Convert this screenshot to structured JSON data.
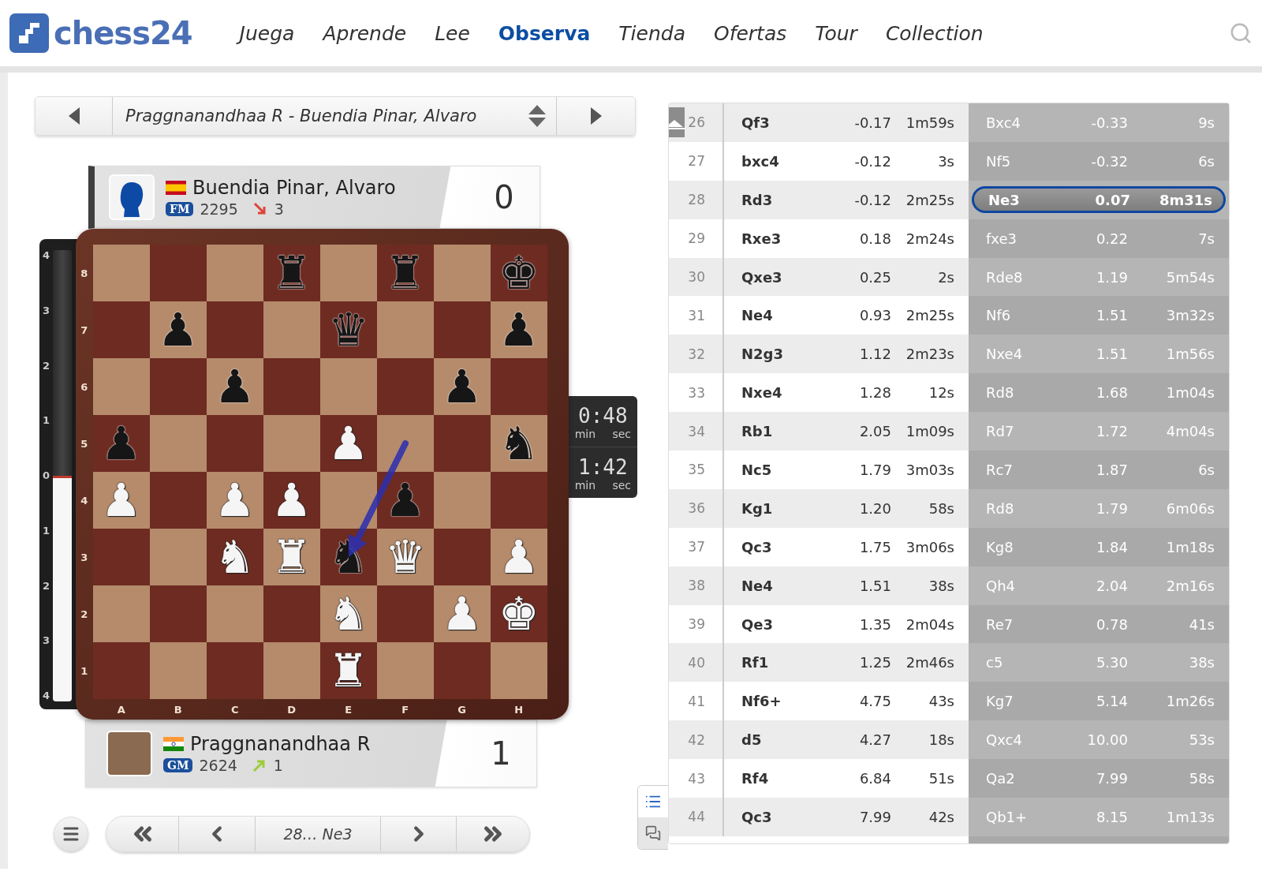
{
  "header": {
    "logo": "chess24",
    "nav": [
      {
        "label": "Juega",
        "selected": false
      },
      {
        "label": "Aprende",
        "selected": false
      },
      {
        "label": "Lee",
        "selected": false
      },
      {
        "label": "Observa",
        "selected": true
      },
      {
        "label": "Tienda",
        "selected": false
      },
      {
        "label": "Ofertas",
        "selected": false
      },
      {
        "label": "Tour",
        "selected": false
      },
      {
        "label": "Collection",
        "selected": false
      }
    ]
  },
  "game_selector": {
    "title": "Praggnanandhaa R - Buendia Pinar, Alvaro"
  },
  "players": [
    {
      "name": "Buendia Pinar, Alvaro",
      "flag": {
        "kind": "es"
      },
      "title": "FM",
      "rating": "2295",
      "trend": {
        "kind": "down"
      },
      "change": "3",
      "score": "0",
      "to_move": true,
      "avatar": {
        "kind": "silhouette"
      }
    },
    {
      "name": "Praggnanandhaa R",
      "flag": {
        "kind": "in"
      },
      "title": "GM",
      "rating": "2624",
      "trend": {
        "kind": "up"
      },
      "change": "1",
      "score": "1",
      "to_move": false,
      "avatar": {
        "kind": "photo"
      }
    }
  ],
  "eval_bar": {
    "ticks": [
      "4",
      "3",
      "2",
      "1",
      "0",
      "1",
      "2",
      "3",
      "4"
    ],
    "level": 0.5
  },
  "board": {
    "ranks": [
      "8",
      "7",
      "6",
      "5",
      "4",
      "3",
      "2",
      "1"
    ],
    "files": [
      "A",
      "B",
      "C",
      "D",
      "E",
      "F",
      "G",
      "H"
    ],
    "rows": [
      [
        {
          "kind": "empty"
        },
        {
          "kind": "empty"
        },
        {
          "kind": "empty"
        },
        {
          "kind": "black",
          "glyph": "♜"
        },
        {
          "kind": "empty"
        },
        {
          "kind": "black",
          "glyph": "♜"
        },
        {
          "kind": "empty"
        },
        {
          "kind": "black",
          "glyph": "♚"
        }
      ],
      [
        {
          "kind": "empty"
        },
        {
          "kind": "black",
          "glyph": "♟"
        },
        {
          "kind": "empty"
        },
        {
          "kind": "empty"
        },
        {
          "kind": "black",
          "glyph": "♛"
        },
        {
          "kind": "empty"
        },
        {
          "kind": "empty"
        },
        {
          "kind": "black",
          "glyph": "♟"
        }
      ],
      [
        {
          "kind": "empty"
        },
        {
          "kind": "empty"
        },
        {
          "kind": "black",
          "glyph": "♟"
        },
        {
          "kind": "empty"
        },
        {
          "kind": "empty"
        },
        {
          "kind": "empty"
        },
        {
          "kind": "black",
          "glyph": "♟"
        },
        {
          "kind": "empty"
        }
      ],
      [
        {
          "kind": "black",
          "glyph": "♟"
        },
        {
          "kind": "empty"
        },
        {
          "kind": "empty"
        },
        {
          "kind": "empty"
        },
        {
          "kind": "white",
          "glyph": "♟"
        },
        {
          "kind": "empty",
          "arrow_start": true
        },
        {
          "kind": "empty"
        },
        {
          "kind": "black",
          "glyph": "♞"
        }
      ],
      [
        {
          "kind": "white",
          "glyph": "♟"
        },
        {
          "kind": "empty"
        },
        {
          "kind": "white",
          "glyph": "♟"
        },
        {
          "kind": "white",
          "glyph": "♟"
        },
        {
          "kind": "empty"
        },
        {
          "kind": "black",
          "glyph": "♟"
        },
        {
          "kind": "empty"
        },
        {
          "kind": "empty"
        }
      ],
      [
        {
          "kind": "empty"
        },
        {
          "kind": "empty"
        },
        {
          "kind": "white",
          "glyph": "♞"
        },
        {
          "kind": "white",
          "glyph": "♜"
        },
        {
          "kind": "black",
          "glyph": "♞",
          "arrow_end": true
        },
        {
          "kind": "white",
          "glyph": "♛"
        },
        {
          "kind": "empty"
        },
        {
          "kind": "white",
          "glyph": "♟"
        }
      ],
      [
        {
          "kind": "empty"
        },
        {
          "kind": "empty"
        },
        {
          "kind": "empty"
        },
        {
          "kind": "empty"
        },
        {
          "kind": "white",
          "glyph": "♞"
        },
        {
          "kind": "empty"
        },
        {
          "kind": "white",
          "glyph": "♟"
        },
        {
          "kind": "white",
          "glyph": "♚"
        }
      ],
      [
        {
          "kind": "empty"
        },
        {
          "kind": "empty"
        },
        {
          "kind": "empty"
        },
        {
          "kind": "empty"
        },
        {
          "kind": "white",
          "glyph": "♜"
        },
        {
          "kind": "empty"
        },
        {
          "kind": "empty"
        },
        {
          "kind": "empty"
        }
      ]
    ]
  },
  "clocks": [
    {
      "time": "0:48",
      "unit_min": "min",
      "unit_sec": "sec"
    },
    {
      "time": "1:42",
      "unit_min": "min",
      "unit_sec": "sec"
    }
  ],
  "navigation": {
    "current": "28… Ne3"
  },
  "side_tabs": [
    {
      "kind": "list",
      "selected": true
    },
    {
      "kind": "chat",
      "selected": false
    }
  ],
  "moves": [
    {
      "number": "26",
      "white": {
        "move": "Qf3",
        "eval": "-0.17",
        "time": "1m59s",
        "selected": false
      },
      "black": {
        "move": "Bxc4",
        "eval": "-0.33",
        "time": "9s",
        "selected": false
      }
    },
    {
      "number": "27",
      "white": {
        "move": "bxc4",
        "eval": "-0.12",
        "time": "3s",
        "selected": false
      },
      "black": {
        "move": "Nf5",
        "eval": "-0.32",
        "time": "6s",
        "selected": false
      }
    },
    {
      "number": "28",
      "white": {
        "move": "Rd3",
        "eval": "-0.12",
        "time": "2m25s",
        "selected": false
      },
      "black": {
        "move": "Ne3",
        "eval": "0.07",
        "time": "8m31s",
        "selected": true
      }
    },
    {
      "number": "29",
      "white": {
        "move": "Rxe3",
        "eval": "0.18",
        "time": "2m24s",
        "selected": false
      },
      "black": {
        "move": "fxe3",
        "eval": "0.22",
        "time": "7s",
        "selected": false
      }
    },
    {
      "number": "30",
      "white": {
        "move": "Qxe3",
        "eval": "0.25",
        "time": "2s",
        "selected": false
      },
      "black": {
        "move": "Rde8",
        "eval": "1.19",
        "time": "5m54s",
        "selected": false
      }
    },
    {
      "number": "31",
      "white": {
        "move": "Ne4",
        "eval": "0.93",
        "time": "2m25s",
        "selected": false
      },
      "black": {
        "move": "Nf6",
        "eval": "1.51",
        "time": "3m32s",
        "selected": false
      }
    },
    {
      "number": "32",
      "white": {
        "move": "N2g3",
        "eval": "1.12",
        "time": "2m23s",
        "selected": false
      },
      "black": {
        "move": "Nxe4",
        "eval": "1.51",
        "time": "1m56s",
        "selected": false
      }
    },
    {
      "number": "33",
      "white": {
        "move": "Nxe4",
        "eval": "1.28",
        "time": "12s",
        "selected": false
      },
      "black": {
        "move": "Rd8",
        "eval": "1.68",
        "time": "1m04s",
        "selected": false
      }
    },
    {
      "number": "34",
      "white": {
        "move": "Rb1",
        "eval": "2.05",
        "time": "1m09s",
        "selected": false
      },
      "black": {
        "move": "Rd7",
        "eval": "1.72",
        "time": "4m04s",
        "selected": false
      }
    },
    {
      "number": "35",
      "white": {
        "move": "Nc5",
        "eval": "1.79",
        "time": "3m03s",
        "selected": false
      },
      "black": {
        "move": "Rc7",
        "eval": "1.87",
        "time": "6s",
        "selected": false
      }
    },
    {
      "number": "36",
      "white": {
        "move": "Kg1",
        "eval": "1.20",
        "time": "58s",
        "selected": false
      },
      "black": {
        "move": "Rd8",
        "eval": "1.79",
        "time": "6m06s",
        "selected": false
      }
    },
    {
      "number": "37",
      "white": {
        "move": "Qc3",
        "eval": "1.75",
        "time": "3m06s",
        "selected": false
      },
      "black": {
        "move": "Kg8",
        "eval": "1.84",
        "time": "1m18s",
        "selected": false
      }
    },
    {
      "number": "38",
      "white": {
        "move": "Ne4",
        "eval": "1.51",
        "time": "38s",
        "selected": false
      },
      "black": {
        "move": "Qh4",
        "eval": "2.04",
        "time": "2m16s",
        "selected": false
      }
    },
    {
      "number": "39",
      "white": {
        "move": "Qe3",
        "eval": "1.35",
        "time": "2m04s",
        "selected": false
      },
      "black": {
        "move": "Re7",
        "eval": "0.78",
        "time": "41s",
        "selected": false
      }
    },
    {
      "number": "40",
      "white": {
        "move": "Rf1",
        "eval": "1.25",
        "time": "2m46s",
        "selected": false
      },
      "black": {
        "move": "c5",
        "eval": "5.30",
        "time": "38s",
        "selected": false
      }
    },
    {
      "number": "41",
      "white": {
        "move": "Nf6+",
        "eval": "4.75",
        "time": "43s",
        "selected": false
      },
      "black": {
        "move": "Kg7",
        "eval": "5.14",
        "time": "1m26s",
        "selected": false
      }
    },
    {
      "number": "42",
      "white": {
        "move": "d5",
        "eval": "4.27",
        "time": "18s",
        "selected": false
      },
      "black": {
        "move": "Qxc4",
        "eval": "10.00",
        "time": "53s",
        "selected": false
      }
    },
    {
      "number": "43",
      "white": {
        "move": "Rf4",
        "eval": "6.84",
        "time": "51s",
        "selected": false
      },
      "black": {
        "move": "Qa2",
        "eval": "7.99",
        "time": "58s",
        "selected": false
      }
    },
    {
      "number": "44",
      "white": {
        "move": "Qc3",
        "eval": "7.99",
        "time": "42s",
        "selected": false
      },
      "black": {
        "move": "Qb1+",
        "eval": "8.15",
        "time": "1m13s",
        "selected": false
      }
    }
  ]
}
